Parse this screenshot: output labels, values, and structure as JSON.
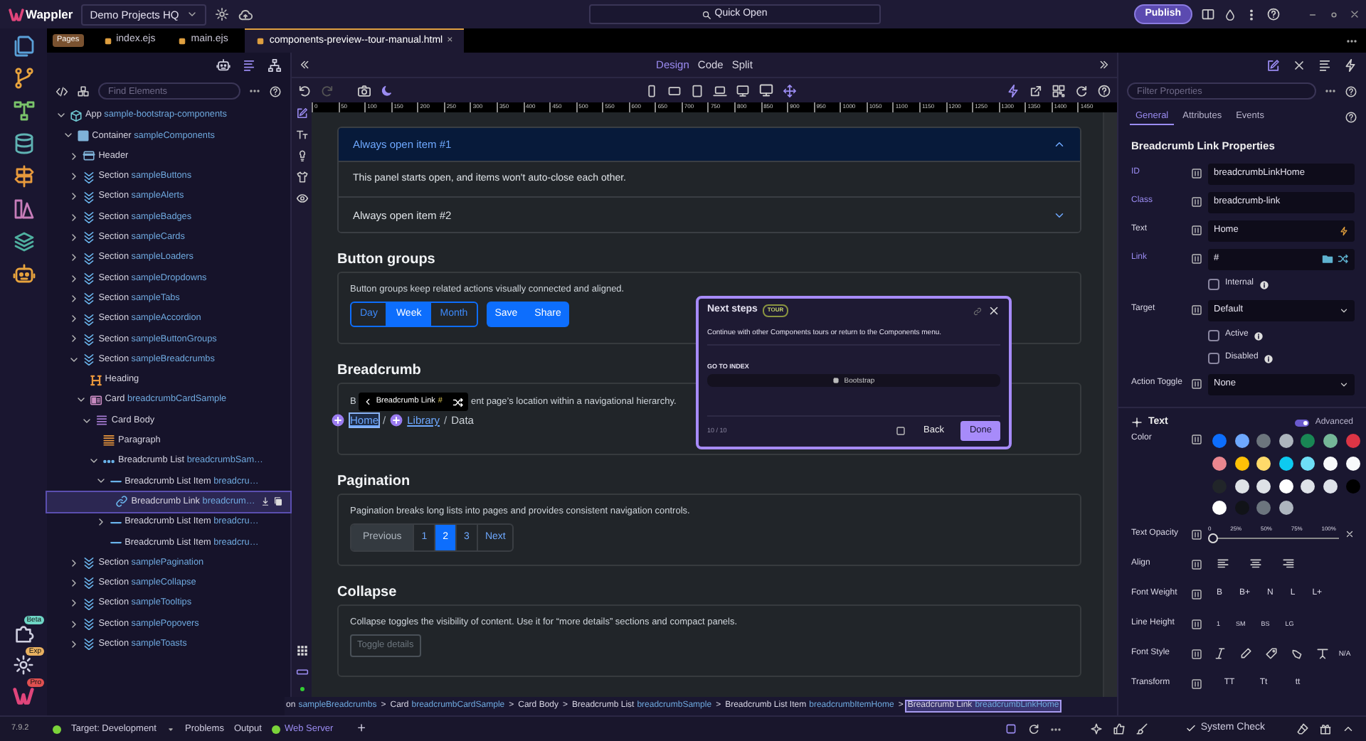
{
  "title_bar": {
    "app_name": "Wappler",
    "project": "Demo Projects HQ",
    "quick_open": "Quick Open",
    "publish": "Publish"
  },
  "activity_badges": [
    "Beta",
    "Exp",
    "Pro"
  ],
  "file_tabs": {
    "tag": "Pages",
    "close": "×",
    "tabs": [
      {
        "label": "index.ejs",
        "selected": false
      },
      {
        "label": "main.ejs",
        "selected": false
      },
      {
        "label": "components-preview--tour-manual.html",
        "selected": true
      }
    ]
  },
  "structure": {
    "find_placeholder": "Find Elements",
    "tree": [
      {
        "type": "App",
        "name": "sample-bootstrap-components",
        "kind": "app",
        "expanded": true,
        "selected": false,
        "children": [
          {
            "type": "Container",
            "name": "sampleComponents",
            "kind": "container",
            "expanded": true,
            "selected": false,
            "children": [
              {
                "type": "Header",
                "kind": "header",
                "expanded": false,
                "selected": false
              },
              {
                "type": "Section",
                "name": "sampleButtons",
                "kind": "section",
                "expanded": false,
                "selected": false
              },
              {
                "type": "Section",
                "name": "sampleAlerts",
                "kind": "section",
                "expanded": false,
                "selected": false
              },
              {
                "type": "Section",
                "name": "sampleBadges",
                "kind": "section",
                "expanded": false,
                "selected": false
              },
              {
                "type": "Section",
                "name": "sampleCards",
                "kind": "section",
                "expanded": false,
                "selected": false
              },
              {
                "type": "Section",
                "name": "sampleLoaders",
                "kind": "section",
                "expanded": false,
                "selected": false
              },
              {
                "type": "Section",
                "name": "sampleDropdowns",
                "kind": "section",
                "expanded": false,
                "selected": false
              },
              {
                "type": "Section",
                "name": "sampleTabs",
                "kind": "section",
                "expanded": false,
                "selected": false
              },
              {
                "type": "Section",
                "name": "sampleAccordion",
                "kind": "section",
                "expanded": false,
                "selected": false
              },
              {
                "type": "Section",
                "name": "sampleButtonGroups",
                "kind": "section",
                "expanded": false,
                "selected": false
              },
              {
                "type": "Section",
                "name": "sampleBreadcrumbs",
                "kind": "section",
                "expanded": true,
                "selected": false,
                "children": [
                  {
                    "type": "Heading",
                    "kind": "heading",
                    "selected": false
                  },
                  {
                    "type": "Card",
                    "name": "breadcrumbCardSample",
                    "kind": "card",
                    "expanded": true,
                    "selected": false,
                    "children": [
                      {
                        "type": "Card Body",
                        "kind": "card-body",
                        "expanded": true,
                        "selected": false,
                        "children": [
                          {
                            "type": "Paragraph",
                            "kind": "paragraph",
                            "selected": false
                          },
                          {
                            "type": "Breadcrumb List",
                            "name": "breadcrumbSam…",
                            "kind": "list",
                            "expanded": true,
                            "selected": false,
                            "children": [
                              {
                                "type": "Breadcrumb List Item",
                                "name": "breadcru…",
                                "kind": "item",
                                "expanded": true,
                                "selected": false,
                                "children": [
                                  {
                                    "type": "Breadcrumb Link",
                                    "name": "breadcrum…",
                                    "kind": "link",
                                    "selected": true
                                  }
                                ]
                              },
                              {
                                "type": "Breadcrumb List Item",
                                "name": "breadcru…",
                                "kind": "item",
                                "expanded": false,
                                "selected": false
                              },
                              {
                                "type": "Breadcrumb List Item",
                                "name": "breadcru…",
                                "kind": "item",
                                "selected": false
                              }
                            ]
                          }
                        ]
                      }
                    ]
                  }
                ]
              },
              {
                "type": "Section",
                "name": "samplePagination",
                "kind": "section",
                "expanded": false,
                "selected": false
              },
              {
                "type": "Section",
                "name": "sampleCollapse",
                "kind": "section",
                "expanded": false,
                "selected": false
              },
              {
                "type": "Section",
                "name": "sampleTooltips",
                "kind": "section",
                "expanded": false,
                "selected": false
              },
              {
                "type": "Section",
                "name": "samplePopovers",
                "kind": "section",
                "expanded": false,
                "selected": false
              },
              {
                "type": "Section",
                "name": "sampleToasts",
                "kind": "section",
                "expanded": false,
                "selected": false
              }
            ]
          }
        ]
      }
    ]
  },
  "view_modes": [
    {
      "label": "Design",
      "selected": true
    },
    {
      "label": "Code",
      "selected": false
    },
    {
      "label": "Split",
      "selected": false
    }
  ],
  "ruler": [
    "0",
    "50",
    "100",
    "150",
    "200",
    "250",
    "300",
    "350",
    "400",
    "450",
    "500",
    "550",
    "600",
    "650",
    "700",
    "750",
    "800",
    "850",
    "900",
    "950",
    "1000",
    "1050",
    "1100",
    "1150",
    "1200",
    "1250",
    "1300",
    "1350",
    "1400",
    "1450"
  ],
  "canvas": {
    "accordion": [
      {
        "title": "Always open item #1",
        "expanded": true,
        "body": "This panel starts open, and items won't auto-close each other."
      },
      {
        "title": "Always open item #2",
        "expanded": false
      }
    ],
    "button_groups": {
      "heading": "Button groups",
      "description": "Button groups keep related actions visually connected and aligned.",
      "outline_group": [
        {
          "label": "Day",
          "selected": false
        },
        {
          "label": "Week",
          "selected": true
        },
        {
          "label": "Month",
          "selected": false
        }
      ],
      "solid_group": [
        "Save",
        "Share"
      ]
    },
    "breadcrumb": {
      "heading": "Breadcrumb",
      "description_start": "B",
      "description_end": "ent page’s location within a navigational hierarchy.",
      "separator": "/",
      "items": [
        {
          "label": "Home",
          "kind": "link",
          "selected": true
        },
        {
          "label": "Library",
          "kind": "link",
          "selected": false
        },
        {
          "label": "Data",
          "kind": "current",
          "selected": false
        }
      ]
    },
    "pagination": {
      "heading": "Pagination",
      "description": "Pagination breaks long lists into pages and provides consistent navigation controls.",
      "items": [
        {
          "label": "Previous",
          "disabled": true,
          "selected": false
        },
        {
          "label": "1",
          "disabled": false,
          "selected": false
        },
        {
          "label": "2",
          "disabled": false,
          "selected": true
        },
        {
          "label": "3",
          "disabled": false,
          "selected": false
        },
        {
          "label": "Next",
          "disabled": false,
          "selected": false
        }
      ]
    },
    "collapse": {
      "heading": "Collapse",
      "description": "Collapse toggles the visibility of content. Use it for “more details” sections and compact panels.",
      "button": "Toggle details"
    }
  },
  "element_tooltip": {
    "label": "Breadcrumb Link",
    "link": "#"
  },
  "tour": {
    "title": "Next steps",
    "badge": "TOUR",
    "body": "Continue with other Components tours or return to the Components menu.",
    "section": "GO TO INDEX",
    "link": "Bootstrap",
    "counter": "10 / 10",
    "back": "Back",
    "done": "Done"
  },
  "path_bar": {
    "separator": ">",
    "segments": [
      {
        "type": "on",
        "name": "sampleBreadcrumbs",
        "selected": false
      },
      {
        "type": "Card",
        "name": "breadcrumbCardSample",
        "selected": false
      },
      {
        "type": "Card Body",
        "selected": false
      },
      {
        "type": "Breadcrumb List",
        "name": "breadcrumbSample",
        "selected": false
      },
      {
        "type": "Breadcrumb List Item",
        "name": "breadcrumbItemHome",
        "selected": false
      },
      {
        "type": "Breadcrumb Link",
        "name": "breadcrumbLinkHome",
        "selected": true
      }
    ]
  },
  "properties": {
    "filter_placeholder": "Filter Properties",
    "tabs": [
      {
        "label": "General",
        "selected": true
      },
      {
        "label": "Attributes",
        "selected": false
      },
      {
        "label": "Events",
        "selected": false
      }
    ],
    "title": "Breadcrumb Link Properties",
    "rows": [
      {
        "kind": "input",
        "label": "ID",
        "value": "breadcrumbLinkHome",
        "set": true
      },
      {
        "kind": "input",
        "label": "Class",
        "value": "breadcrumb-link",
        "set": true
      },
      {
        "kind": "text",
        "label": "Text",
        "value": "Home",
        "set": false
      },
      {
        "kind": "link",
        "label": "Link",
        "value": "#",
        "set": true
      },
      {
        "kind": "checkbox",
        "label": "Internal",
        "checked": false
      },
      {
        "kind": "select",
        "label": "Target",
        "value": "Default",
        "set": false
      },
      {
        "kind": "checkbox",
        "label": "Active",
        "checked": false
      },
      {
        "kind": "checkbox",
        "label": "Disabled",
        "checked": false
      },
      {
        "kind": "select",
        "label": "Action Toggle",
        "value": "None",
        "set": false
      }
    ],
    "text_section": {
      "title": "Text",
      "advanced": {
        "label": "Advanced",
        "on": true
      },
      "color_label": "Color",
      "colors": [
        {
          "color": "#0d6efd"
        },
        {
          "color": "#6ea8fe"
        },
        {
          "color": "#6c757d"
        },
        {
          "color": "#adb5bd"
        },
        {
          "color": "#198754"
        },
        {
          "color": "#75b798"
        },
        {
          "color": "#dc3545"
        },
        {
          "color": "#ea868f"
        },
        {
          "color": "#ffc107"
        },
        {
          "color": "#ffda6a"
        },
        {
          "color": "#0dcaf0"
        },
        {
          "color": "#6edff6"
        },
        {
          "color": "#f8f9fa"
        },
        {
          "color": "#f8f9fb"
        },
        {
          "color": "#212529"
        },
        {
          "color": "#dee2e6"
        },
        {
          "color": "#dee2e7"
        },
        {
          "color": "#ffffff"
        },
        {
          "color": "#dee2e8"
        },
        {
          "color": "#dee2e9"
        },
        {
          "color": "#000000"
        },
        {
          "color": "#fffffe"
        },
        {
          "color": "#111318"
        },
        {
          "color": "#6c757e"
        },
        {
          "color": "#adb5be"
        }
      ],
      "opacity": {
        "label": "Text Opacity",
        "ticks": [
          "0",
          "25%",
          "50%",
          "75%",
          "100%"
        ],
        "level": 0
      },
      "align_label": "Align",
      "weight": {
        "label": "Font Weight",
        "options": [
          "B",
          "B+",
          "N",
          "L",
          "L+"
        ]
      },
      "line_height": {
        "label": "Line Height",
        "options": [
          "1",
          "SM",
          "BS",
          "LG"
        ]
      },
      "style": {
        "label": "Font Style",
        "na": "N/A"
      },
      "transform": {
        "label": "Transform",
        "options": [
          "TT",
          "Tt",
          "tt"
        ]
      }
    }
  },
  "status_bar": {
    "version": "7.9.2",
    "target": "Target: Development",
    "tabs": [
      "Problems",
      "Output"
    ],
    "server": "Web Server",
    "add": "+",
    "system_check": "System Check"
  }
}
